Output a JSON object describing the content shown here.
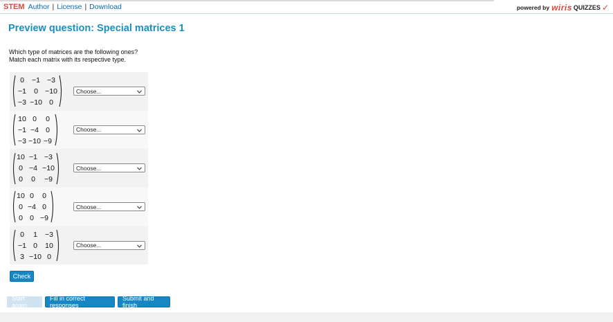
{
  "header": {
    "brand": "STEM",
    "links": [
      "Author",
      "License",
      "Download"
    ],
    "separator": "|",
    "powered_by": "powered by",
    "powered_brand": "wiris",
    "powered_product": "QUIZZES",
    "check_glyph": "✓"
  },
  "page_title": "Preview question: Special matrices 1",
  "prompt": {
    "line1": "Which type of matrices are the following ones?",
    "line2": "Match each matrix with its respective type."
  },
  "rows": [
    {
      "matrix": [
        [
          "0",
          "−1",
          "−3"
        ],
        [
          "−1",
          "0",
          "−10"
        ],
        [
          "−3",
          "−10",
          "0"
        ]
      ],
      "select": "Choose..."
    },
    {
      "matrix": [
        [
          "10",
          "0",
          "0"
        ],
        [
          "−1",
          "−4",
          "0"
        ],
        [
          "−3",
          "−10",
          "−9"
        ]
      ],
      "select": "Choose..."
    },
    {
      "matrix": [
        [
          "10",
          "−1",
          "−3"
        ],
        [
          "0",
          "−4",
          "−10"
        ],
        [
          "0",
          "0",
          "−9"
        ]
      ],
      "select": "Choose..."
    },
    {
      "matrix": [
        [
          "10",
          "0",
          "0"
        ],
        [
          "0",
          "−4",
          "0"
        ],
        [
          "0",
          "0",
          "−9"
        ]
      ],
      "select": "Choose..."
    },
    {
      "matrix": [
        [
          "0",
          "1",
          "−3"
        ],
        [
          "−1",
          "0",
          "10"
        ],
        [
          "3",
          "−10",
          "0"
        ]
      ],
      "select": "Choose..."
    }
  ],
  "buttons": {
    "check": "Check",
    "start_again": "Start again",
    "fill_correct": "Fill in correct responses",
    "submit": "Submit and finish"
  },
  "colors": {
    "accent": "#1787c4",
    "title": "#1a8fc0",
    "brand_red": "#e0453a"
  }
}
